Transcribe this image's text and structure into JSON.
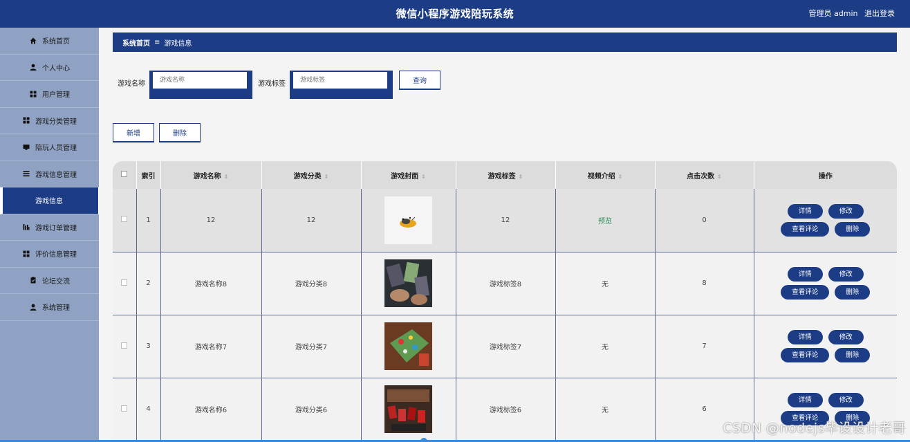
{
  "header": {
    "title": "微信小程序游戏陪玩系统",
    "user_label": "管理员 admin",
    "logout_label": "退出登录"
  },
  "sidebar": {
    "items": [
      {
        "label": "系统首页",
        "icon": "home-icon"
      },
      {
        "label": "个人中心",
        "icon": "user-icon"
      },
      {
        "label": "用户管理",
        "icon": "grid-icon"
      },
      {
        "label": "游戏分类管理",
        "icon": "grid-icon"
      },
      {
        "label": "陪玩人员管理",
        "icon": "monitor-icon"
      },
      {
        "label": "游戏信息管理",
        "icon": "list-icon"
      },
      {
        "label": "游戏信息",
        "icon": "",
        "active": true
      },
      {
        "label": "游戏订单管理",
        "icon": "chart-icon"
      },
      {
        "label": "评价信息管理",
        "icon": "grid-icon"
      },
      {
        "label": "论坛交流",
        "icon": "clipboard-icon"
      },
      {
        "label": "系统管理",
        "icon": "user-icon"
      }
    ]
  },
  "breadcrumb": {
    "home": "系统首页",
    "separator": "≡",
    "current": "游戏信息"
  },
  "search": {
    "name_label": "游戏名称",
    "name_placeholder": "游戏名称",
    "tag_label": "游戏标签",
    "tag_placeholder": "游戏标签",
    "query_button": "查询"
  },
  "actions": {
    "add_button": "新增",
    "delete_button": "删除"
  },
  "table": {
    "headers": [
      "索引",
      "游戏名称",
      "游戏分类",
      "游戏封面",
      "游戏标签",
      "视频介绍",
      "点击次数",
      "操作"
    ],
    "rows": [
      {
        "index": "1",
        "name": "12",
        "category": "12",
        "cover": "cat-cover",
        "tag": "12",
        "video": "预览",
        "clicks": "0"
      },
      {
        "index": "2",
        "name": "游戏名称8",
        "category": "游戏分类8",
        "cover": "phone-cover",
        "tag": "游戏标签8",
        "video": "无",
        "clicks": "8"
      },
      {
        "index": "3",
        "name": "游戏名称7",
        "category": "游戏分类7",
        "cover": "board-cover",
        "tag": "游戏标签7",
        "video": "无",
        "clicks": "7"
      },
      {
        "index": "4",
        "name": "游戏名称6",
        "category": "游戏分类6",
        "cover": "cards-cover",
        "tag": "游戏标签6",
        "video": "无",
        "clicks": "6"
      }
    ],
    "op_labels": {
      "detail": "详情",
      "edit": "修改",
      "comments": "查看评论",
      "delete": "删除"
    }
  },
  "watermark": "CSDN @nodejs毕设设计老哥",
  "colors": {
    "primary": "#1c3c85",
    "sidebar": "#8fa2c3",
    "preview_link": "#2e8b57"
  }
}
